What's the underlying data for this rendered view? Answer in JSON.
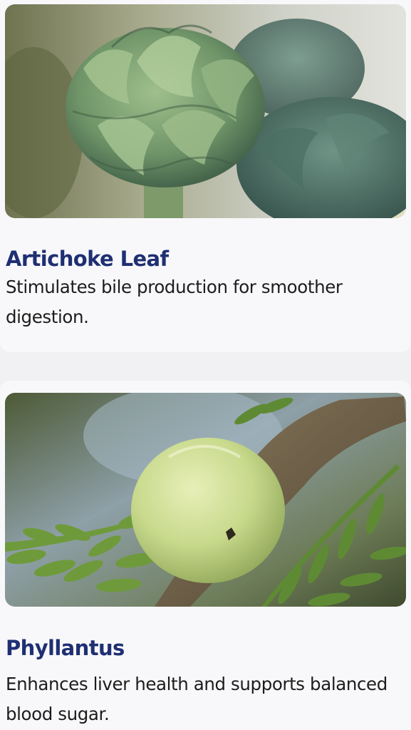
{
  "cards": [
    {
      "title": "Artichoke Leaf",
      "description": "Stimulates bile production for smoother digestion.",
      "image_subject": "artichoke-photo"
    },
    {
      "title": "Phyllantus",
      "description": "Enhances liver health and supports balanced blood sugar.",
      "image_subject": "amla-fruit-photo"
    }
  ],
  "colors": {
    "title": "#1f2f73",
    "body_text": "#1c1c1c",
    "card_background": "#f8f8fa",
    "page_background": "#f1f1f4"
  }
}
